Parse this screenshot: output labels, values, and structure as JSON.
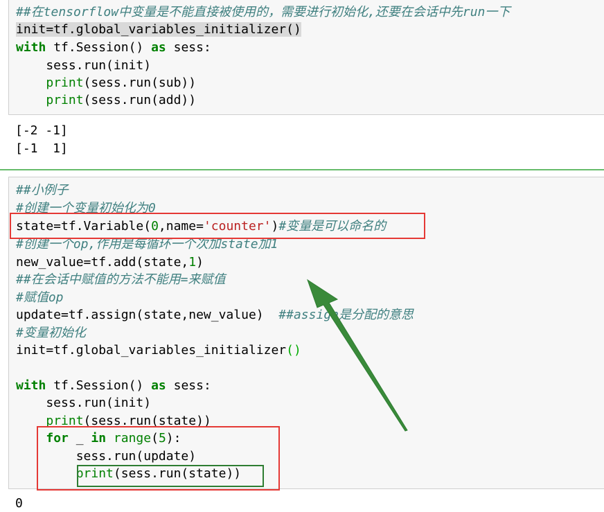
{
  "cell1": {
    "lines": [
      "##在tensorflow中变量是不能直接被使用的，需要进行初始化,还要在会话中先run一下",
      "init=tf.global_variables_initializer()",
      "with",
      " tf.Session() ",
      "as",
      " sess:",
      "    sess.run(init)",
      "print",
      "(sess.run(sub))",
      "print",
      "(sess.run(add))"
    ]
  },
  "output1": [
    "[-2 -1]",
    "[-1  1]"
  ],
  "cell2": {
    "c1": "##小例子",
    "c2": "#创建一个变量初始化为0",
    "l3a": "state=tf.Variable(",
    "l3b": "0",
    "l3c": ",name=",
    "l3d": "'counter'",
    "l3e": ")",
    "l3f": "#变量是可以命名的",
    "c4": "#创建一个op,作用是每循环一个次加state加1",
    "l5a": "new_value=tf.add(state,",
    "l5b": "1",
    "l5c": ")",
    "c6": "##在会话中赋值的方法不能用=来赋值",
    "c7": "#赋值op",
    "l8a": "update=tf.assign(state,new_value)  ",
    "l8b": "##assign是分配的意思",
    "c9": "#变量初始化",
    "l10a": "init=tf.global_variables_initializer",
    "l10b": "()",
    "l12a": "with",
    "l12b": " tf.Session() ",
    "l12c": "as",
    "l12d": " sess:",
    "l13": "    sess.run(init)",
    "l14a": "print",
    "l14b": "(sess.run(state))",
    "l15a": "for",
    "l15b": " _ ",
    "l15c": "in",
    "l15d": " ",
    "l15e": "range",
    "l15f": "(",
    "l15g": "5",
    "l15h": "):",
    "l16": "        sess.run(update)",
    "l17a": "print",
    "l17b": "(sess.run(state))"
  },
  "output2_partial": "0",
  "annotation_colors": {
    "red": "#e53935",
    "green": "#2e7d32"
  }
}
